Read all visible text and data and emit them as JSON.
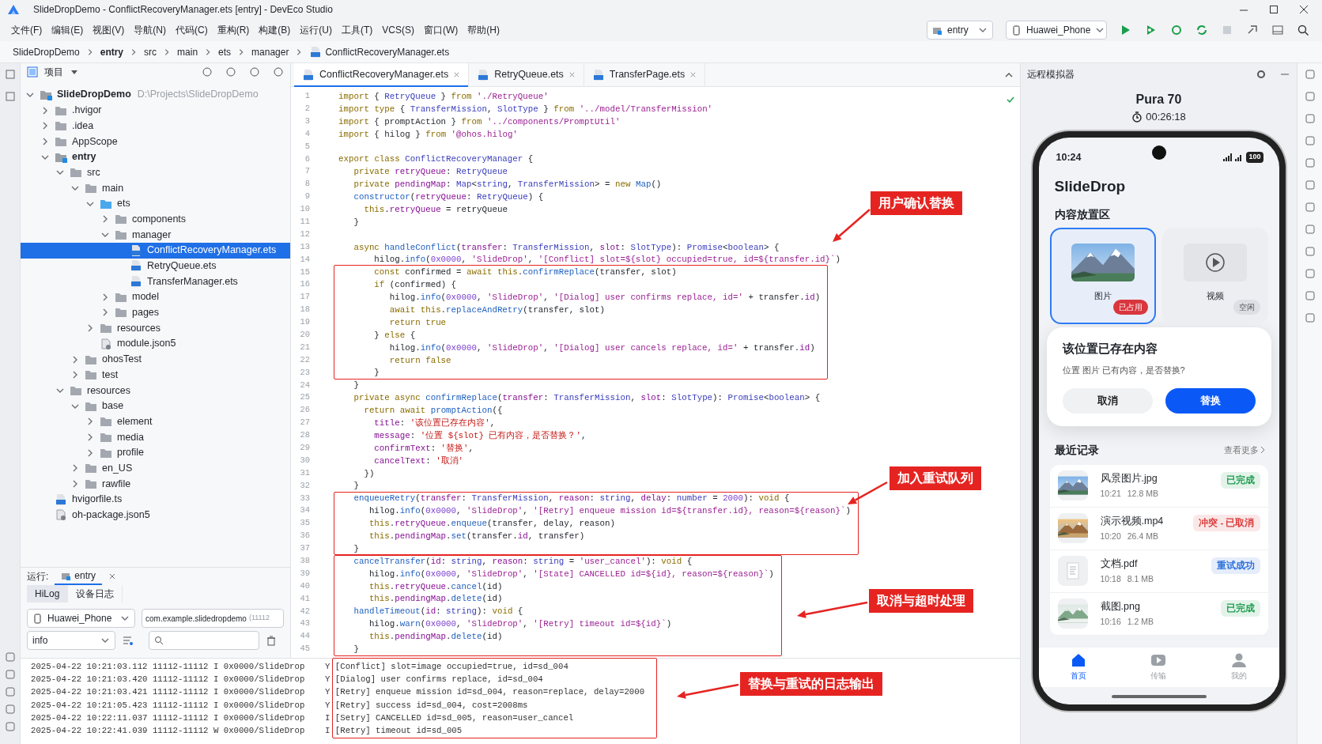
{
  "window": {
    "title": "SlideDropDemo - ConflictRecoveryManager.ets [entry] - DevEco Studio"
  },
  "menu": [
    "文件(F)",
    "编辑(E)",
    "视图(V)",
    "导航(N)",
    "代码(C)",
    "重构(R)",
    "构建(B)",
    "运行(U)",
    "工具(T)",
    "VCS(S)",
    "窗口(W)",
    "帮助(H)"
  ],
  "toolbar": {
    "module": "entry",
    "device": "Huawei_Phone"
  },
  "breadcrumb": [
    {
      "label": "SlideDropDemo",
      "kind": "project"
    },
    {
      "label": "entry",
      "kind": "module"
    },
    {
      "label": "src",
      "kind": "folder"
    },
    {
      "label": "main",
      "kind": "folder"
    },
    {
      "label": "ets",
      "kind": "folder"
    },
    {
      "label": "manager",
      "kind": "folder"
    },
    {
      "label": "ConflictRecoveryManager.ets",
      "kind": "file"
    }
  ],
  "project": {
    "title": "项目",
    "tree": [
      {
        "label": "SlideDropDemo",
        "hint": "D:\\Projects\\SlideDropDemo",
        "kind": "module",
        "expanded": true,
        "selected": false,
        "children": [
          {
            "label": ".hvigor",
            "kind": "folder",
            "expanded": false,
            "selected": false
          },
          {
            "label": ".idea",
            "kind": "folder",
            "expanded": false,
            "selected": false
          },
          {
            "label": "AppScope",
            "kind": "folder",
            "expanded": false,
            "selected": false
          },
          {
            "label": "entry",
            "kind": "module",
            "expanded": true,
            "selected": false,
            "children": [
              {
                "label": "src",
                "kind": "folder",
                "expanded": true,
                "selected": false,
                "children": [
                  {
                    "label": "main",
                    "kind": "folder",
                    "expanded": true,
                    "selected": false,
                    "children": [
                      {
                        "label": "ets",
                        "kind": "source-folder",
                        "expanded": true,
                        "selected": false,
                        "children": [
                          {
                            "label": "components",
                            "kind": "folder",
                            "expanded": false,
                            "selected": false
                          },
                          {
                            "label": "manager",
                            "kind": "folder",
                            "expanded": true,
                            "selected": false,
                            "children": [
                              {
                                "label": "ConflictRecoveryManager.ets",
                                "kind": "ets-file",
                                "selected": true
                              },
                              {
                                "label": "RetryQueue.ets",
                                "kind": "ets-file",
                                "selected": false
                              },
                              {
                                "label": "TransferManager.ets",
                                "kind": "ets-file",
                                "selected": false
                              }
                            ]
                          },
                          {
                            "label": "model",
                            "kind": "folder",
                            "expanded": false,
                            "selected": false
                          },
                          {
                            "label": "pages",
                            "kind": "folder",
                            "expanded": false,
                            "selected": false
                          }
                        ]
                      },
                      {
                        "label": "resources",
                        "kind": "folder",
                        "expanded": false,
                        "selected": false
                      },
                      {
                        "label": "module.json5",
                        "kind": "config-file",
                        "selected": false
                      }
                    ]
                  },
                  {
                    "label": "ohosTest",
                    "kind": "folder",
                    "expanded": false,
                    "selected": false
                  },
                  {
                    "label": "test",
                    "kind": "folder",
                    "expanded": false,
                    "selected": false
                  }
                ]
              },
              {
                "label": "resources",
                "kind": "folder",
                "expanded": true,
                "selected": false,
                "children": [
                  {
                    "label": "base",
                    "kind": "folder",
                    "expanded": true,
                    "selected": false,
                    "children": [
                      {
                        "label": "element",
                        "kind": "folder",
                        "expanded": false,
                        "selected": false
                      },
                      {
                        "label": "media",
                        "kind": "folder",
                        "expanded": false,
                        "selected": false
                      },
                      {
                        "label": "profile",
                        "kind": "folder",
                        "expanded": false,
                        "selected": false
                      }
                    ]
                  },
                  {
                    "label": "en_US",
                    "kind": "folder",
                    "expanded": false,
                    "selected": false
                  },
                  {
                    "label": "rawfile",
                    "kind": "folder",
                    "expanded": false,
                    "selected": false
                  }
                ]
              }
            ]
          },
          {
            "label": "hvigorfile.ts",
            "kind": "ets-file",
            "selected": false
          },
          {
            "label": "oh-package.json5",
            "kind": "config-file",
            "selected": false
          }
        ]
      }
    ]
  },
  "run_panel": {
    "label": "运行:",
    "tab": "entry",
    "log_tabs": [
      {
        "label": "HiLog",
        "selected": true
      },
      {
        "label": "设备日志",
        "selected": false
      }
    ],
    "device": "Huawei_Phone",
    "package": "com.example.slidedropdemo",
    "pid": "(11112",
    "level": "info"
  },
  "editor": {
    "tabs": [
      {
        "label": "ConflictRecoveryManager.ets",
        "selected": true
      },
      {
        "label": "RetryQueue.ets",
        "selected": false
      },
      {
        "label": "TransferPage.ets",
        "selected": false
      }
    ],
    "lines": [
      {
        "n": "1",
        "code": "import { RetryQueue } from './RetryQueue'"
      },
      {
        "n": "2",
        "code": "import type { TransferMission, SlotType } from '../model/TransferMission'"
      },
      {
        "n": "3",
        "code": "import { promptAction } from '../components/PromptUtil'"
      },
      {
        "n": "4",
        "code": "import { hilog } from '@ohos.hilog'"
      },
      {
        "n": "5"
      },
      {
        "n": "6",
        "code": "export class ConflictRecoveryManager {"
      },
      {
        "n": "7",
        "code": "   private retryQueue: RetryQueue"
      },
      {
        "n": "8",
        "code": "   private pendingMap: Map<string, TransferMission> = new Map()"
      },
      {
        "n": "9",
        "code": "   constructor(retryQueue: RetryQueue) {"
      },
      {
        "n": "10",
        "code": "     this.retryQueue = retryQueue"
      },
      {
        "n": "11",
        "code": "   }"
      },
      {
        "n": "12"
      },
      {
        "n": "13",
        "code": "   async handleConflict(transfer: TransferMission, slot: SlotType): Promise<boolean> {"
      },
      {
        "n": "14",
        "code": "       hilog.info(0x0000, 'SlideDrop', '[Conflict] slot=${slot} occupied=true, id=${transfer.id}`)"
      },
      {
        "n": "15",
        "code": "       const confirmed = await this.confirmReplace(transfer, slot)"
      },
      {
        "n": "16",
        "code": "       if (confirmed) {"
      },
      {
        "n": "17",
        "code": "          hilog.info(0x0000, 'SlideDrop', '[Dialog] user confirms replace, id=' + transfer.id)"
      },
      {
        "n": "18",
        "code": "          await this.replaceAndRetry(transfer, slot)"
      },
      {
        "n": "19",
        "code": "          return true"
      },
      {
        "n": "20",
        "code": "       } else {"
      },
      {
        "n": "21",
        "code": "          hilog.info(0x0000, 'SlideDrop', '[Dialog] user cancels replace, id=' + transfer.id)"
      },
      {
        "n": "22",
        "code": "          return false"
      },
      {
        "n": "23",
        "code": "       }"
      },
      {
        "n": "24",
        "code": "   }"
      },
      {
        "n": "25",
        "code": "   private async confirmReplace(transfer: TransferMission, slot: SlotType): Promise<boolean> {"
      },
      {
        "n": "26",
        "code": "     return await promptAction({"
      },
      {
        "n": "27",
        "code": "       title: '该位置已存在内容',"
      },
      {
        "n": "28",
        "code": "       message: '位置 ${slot} 已有内容，是否替换？',"
      },
      {
        "n": "29",
        "code": "       confirmText: '替换',"
      },
      {
        "n": "30",
        "code": "       cancelText: '取消'"
      },
      {
        "n": "31",
        "code": "     })"
      },
      {
        "n": "32",
        "code": "   }"
      },
      {
        "n": "33",
        "code": "   enqueueRetry(transfer: TransferMission, reason: string, delay: number = 2000): void {"
      },
      {
        "n": "34",
        "code": "      hilog.info(0x0000, 'SlideDrop', '[Retry] enqueue mission id=${transfer.id}, reason=${reason}`)"
      },
      {
        "n": "35",
        "code": "      this.retryQueue.enqueue(transfer, delay, reason)"
      },
      {
        "n": "36",
        "code": "      this.pendingMap.set(transfer.id, transfer)"
      },
      {
        "n": "37",
        "code": "   }"
      },
      {
        "n": "38",
        "code": "   cancelTransfer(id: string, reason: string = 'user_cancel'): void {"
      },
      {
        "n": "39",
        "code": "      hilog.info(0x0000, 'SlideDrop', '[State] CANCELLED id=${id}, reason=${reason}`)"
      },
      {
        "n": "40",
        "code": "      this.retryQueue.cancel(id)"
      },
      {
        "n": "41",
        "code": "      this.pendingMap.delete(id)"
      },
      {
        "n": "42",
        "code": "   handleTimeout(id: string): void {"
      },
      {
        "n": "43",
        "code": "      hilog.warn(0x0000, 'SlideDrop', '[Retry] timeout id=${id}`)"
      },
      {
        "n": "44",
        "code": "      this.pendingMap.delete(id)"
      },
      {
        "n": "45",
        "code": "   }"
      }
    ]
  },
  "annotations": [
    {
      "label": "用户确认替换"
    },
    {
      "label": "加入重试队列"
    },
    {
      "label": "取消与超时处理"
    },
    {
      "label": "替换与重试的日志输出"
    }
  ],
  "log": [
    {
      "time": "2025-04-22 10:21:03.112",
      "pid": "11112-11112",
      "level": "I",
      "tag": "0x0000/SlideDrop",
      "column_5": "Y",
      "message": "[Conflict] slot=image occupied=true, id=sd_004"
    },
    {
      "time": "2025-04-22 10:21:03.420",
      "pid": "11112-11112",
      "level": "I",
      "tag": "0x0000/SlideDrop",
      "column_5": "Y",
      "message": "[Dialog] user confirms replace, id=sd_004"
    },
    {
      "time": "2025-04-22 10:21:03.421",
      "pid": "11112-11112",
      "level": "I",
      "tag": "0x0000/SlideDrop",
      "column_5": "Y",
      "message": "[Retry] enqueue mission id=sd_004, reason=replace, delay=2000"
    },
    {
      "time": "2025-04-22 10:21:05.423",
      "pid": "11112-11112",
      "level": "I",
      "tag": "0x0000/SlideDrop",
      "column_5": "Y",
      "message": "[Retry] success id=sd_004, cost=2008ms"
    },
    {
      "time": "2025-04-22 10:22:11.037",
      "pid": "11112-11112",
      "level": "I",
      "tag": "0x0000/SlideDrop",
      "column_5": "I",
      "message": "[Setry] CANCELLED id=sd_005, reason=user_cancel"
    },
    {
      "time": "2025-04-22 10:22:41.039",
      "pid": "11112-11112",
      "level": "W",
      "tag": "0x0000/SlideDrop",
      "column_5": "I",
      "message": "[Retry] timeout id=sd_005"
    }
  ],
  "emulator": {
    "title": "远程模拟器",
    "device": "Pura 70",
    "timer": "00:26:18",
    "phone": {
      "time": "10:24",
      "battery": "100",
      "app_title": "SlideDrop",
      "section": "内容放置区",
      "slots": [
        {
          "label": "图片",
          "status": "已占用",
          "kind": "picture",
          "selected": true,
          "occupied": true
        },
        {
          "label": "视频",
          "status": "空闲",
          "kind": "video",
          "selected": false,
          "occupied": false
        }
      ],
      "dialog": {
        "title": "该位置已存在内容",
        "message": "位置 图片 已有内容，是否替换?",
        "buttons": [
          {
            "label": "取消",
            "kind": "cancel"
          },
          {
            "label": "替换",
            "kind": "confirm"
          }
        ]
      },
      "recent": {
        "title": "最近记录",
        "more": "查看更多",
        "items": [
          {
            "name": "风景图片.jpg",
            "time": "10:21",
            "size": "12.8 MB",
            "status": "已完成",
            "color": "#1e9e4f",
            "kind": "picture"
          },
          {
            "name": "演示视频.mp4",
            "time": "10:20",
            "size": "26.4 MB",
            "status": "冲突 - 已取消",
            "color": "#d93a3a",
            "kind": "picture"
          },
          {
            "name": "文档.pdf",
            "time": "10:18",
            "size": "8.1 MB",
            "status": "重试成功",
            "color": "#2a6fdb",
            "kind": "document"
          },
          {
            "name": "截图.png",
            "time": "10:16",
            "size": "1.2 MB",
            "status": "已完成",
            "color": "#1e9e4f",
            "kind": "picture"
          }
        ]
      },
      "nav": [
        {
          "label": "首页",
          "kind": "home",
          "selected": true
        },
        {
          "label": "传输",
          "kind": "transfer",
          "selected": false
        },
        {
          "label": "我的",
          "kind": "profile",
          "selected": false
        }
      ]
    }
  }
}
